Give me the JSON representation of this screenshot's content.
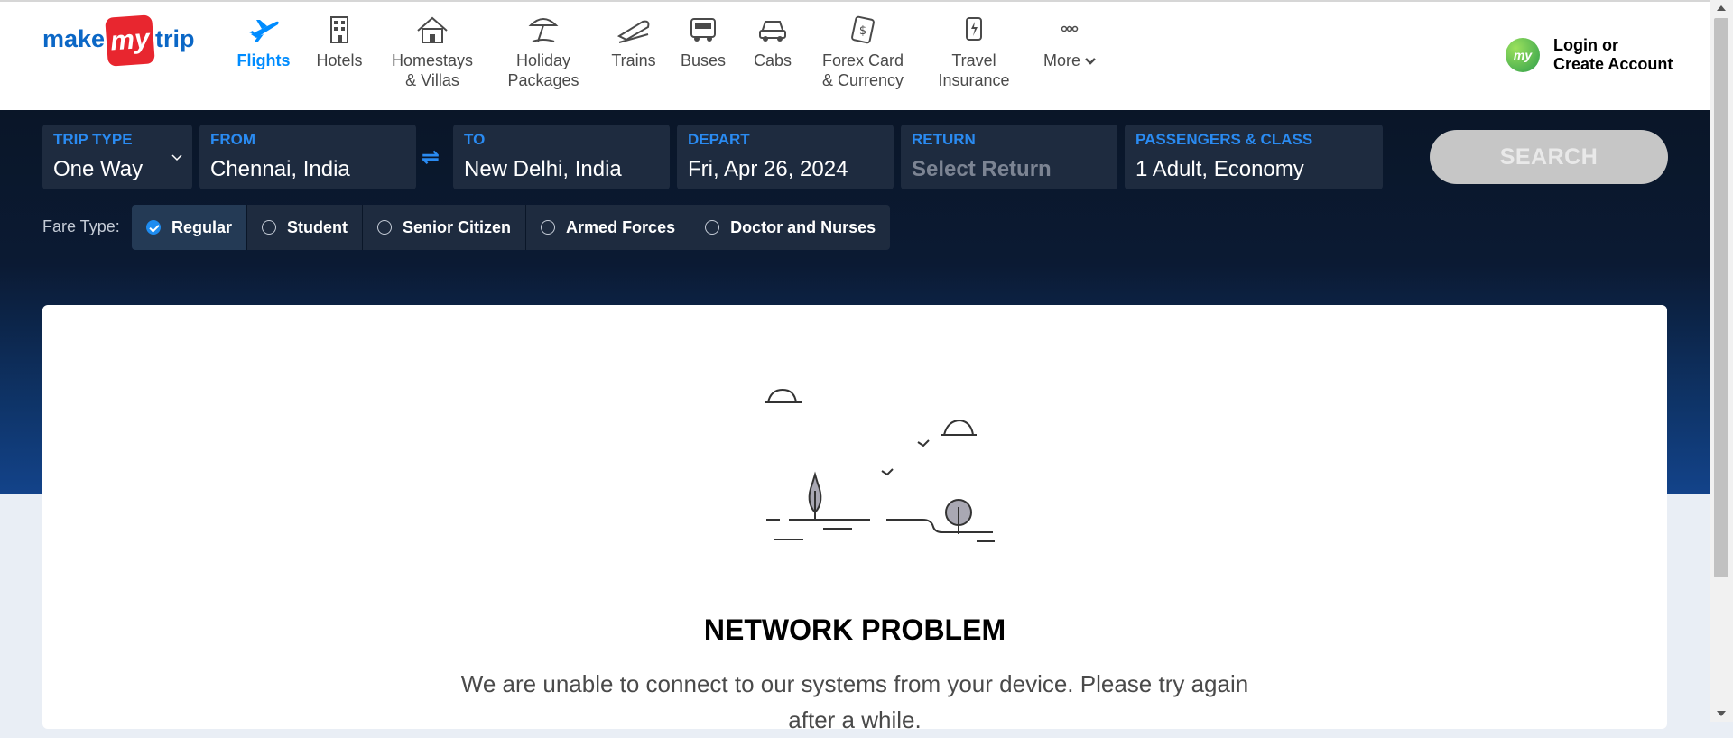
{
  "brand": {
    "w1": "make",
    "w2": "my",
    "w3": "trip"
  },
  "nav": {
    "flights": {
      "l1": "Flights",
      "l2": ""
    },
    "hotels": {
      "l1": "Hotels",
      "l2": ""
    },
    "homestays": {
      "l1": "Homestays",
      "l2": "& Villas"
    },
    "holiday": {
      "l1": "Holiday",
      "l2": "Packages"
    },
    "trains": {
      "l1": "Trains",
      "l2": ""
    },
    "buses": {
      "l1": "Buses",
      "l2": ""
    },
    "cabs": {
      "l1": "Cabs",
      "l2": ""
    },
    "forex": {
      "l1": "Forex Card",
      "l2": "& Currency"
    },
    "insurance": {
      "l1": "Travel",
      "l2": "Insurance"
    },
    "more": {
      "l1": "More",
      "l2": ""
    }
  },
  "login": {
    "line1": "Login or",
    "line2": "Create Account",
    "avatar": "my"
  },
  "search": {
    "trip_type": {
      "label": "TRIP TYPE",
      "value": "One Way"
    },
    "from": {
      "label": "FROM",
      "value": "Chennai, India"
    },
    "swap_icon": "⇌",
    "to": {
      "label": "TO",
      "value": "New Delhi, India"
    },
    "depart": {
      "label": "DEPART",
      "value": "Fri, Apr 26, 2024"
    },
    "return": {
      "label": "RETURN",
      "value": "Select Return"
    },
    "passengers": {
      "label": "PASSENGERS & CLASS",
      "value": "1 Adult, Economy"
    },
    "button": "SEARCH"
  },
  "fare": {
    "label": "Fare Type:",
    "options": [
      "Regular",
      "Student",
      "Senior Citizen",
      "Armed Forces",
      "Doctor and Nurses"
    ],
    "selected": "Regular"
  },
  "error": {
    "title": "NETWORK PROBLEM",
    "message": "We are unable to connect to our systems from your device. Please try again after a while."
  },
  "colors": {
    "accent": "#008cff",
    "brand_red": "#e8262f",
    "brand_blue": "#0b67c6",
    "hero_dark": "#0a1628"
  }
}
